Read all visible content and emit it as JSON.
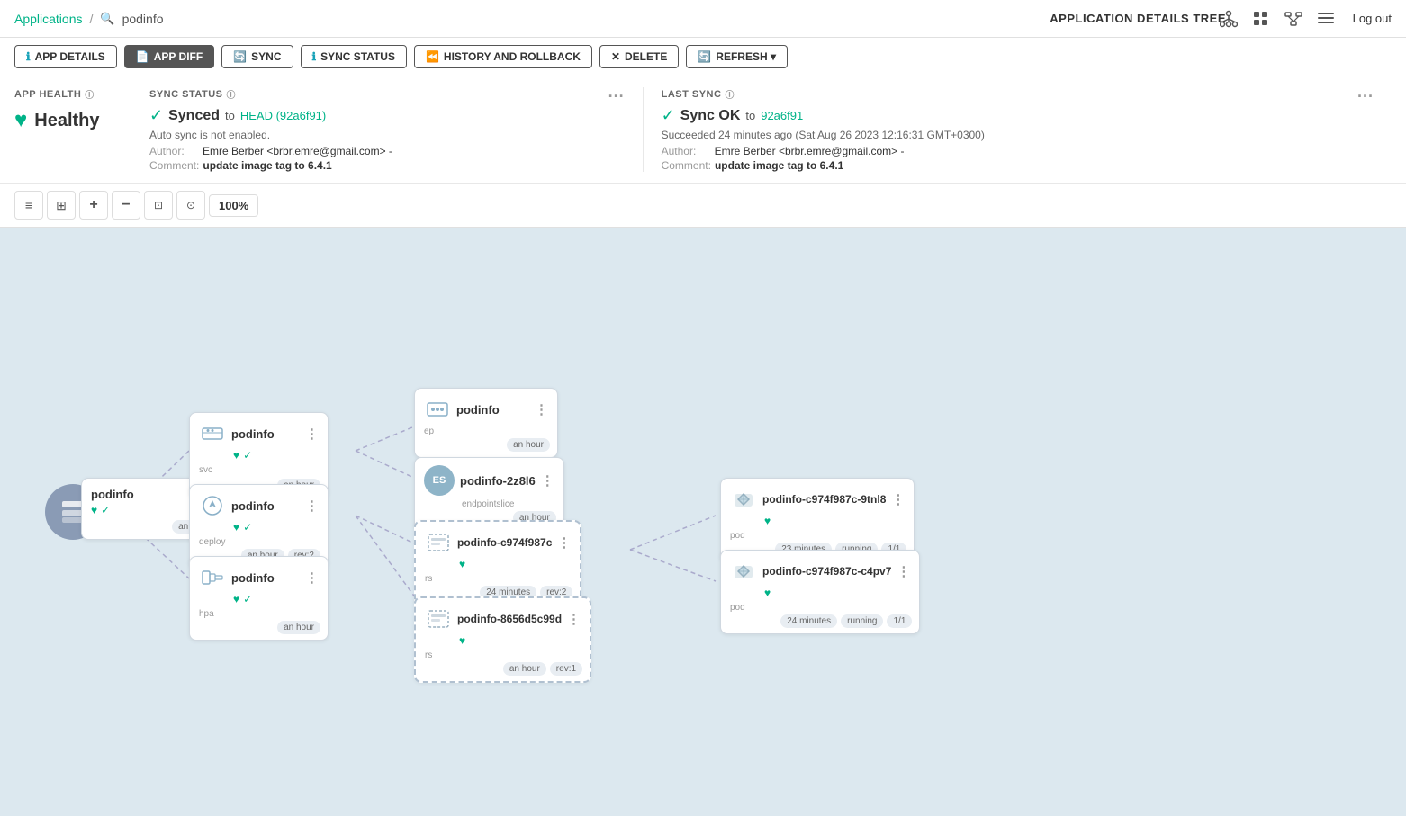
{
  "breadcrumb": {
    "app_link": "Applications",
    "separator": "/",
    "search_icon": "🔍",
    "current": "podinfo"
  },
  "header": {
    "title": "APPLICATION DETAILS TREE",
    "logout": "Log out"
  },
  "toolbar": {
    "buttons": [
      {
        "label": "APP DETAILS",
        "icon": "ℹ",
        "key": "app-details",
        "active": false
      },
      {
        "label": "APP DIFF",
        "icon": "📄",
        "key": "app-diff",
        "active": true
      },
      {
        "label": "SYNC",
        "icon": "🔄",
        "key": "sync",
        "active": false
      },
      {
        "label": "SYNC STATUS",
        "icon": "ℹ",
        "key": "sync-status",
        "active": false
      },
      {
        "label": "HISTORY AND ROLLBACK",
        "icon": "⏪",
        "key": "history",
        "active": false
      },
      {
        "label": "DELETE",
        "icon": "✕",
        "key": "delete",
        "active": false
      },
      {
        "label": "REFRESH ▾",
        "icon": "🔄",
        "key": "refresh",
        "active": false
      }
    ]
  },
  "status": {
    "app_health": {
      "label": "APP HEALTH",
      "value": "Healthy",
      "icon": "heart"
    },
    "sync_status": {
      "label": "SYNC STATUS",
      "value": "Synced",
      "to_text": "to",
      "head_link": "HEAD (92a6f91)",
      "auto_sync": "Auto sync is not enabled.",
      "author_label": "Author:",
      "author_value": "Emre Berber <brbr.emre@gmail.com> -",
      "comment_label": "Comment:",
      "comment_value": "update image tag to 6.4.1"
    },
    "last_sync": {
      "label": "LAST SYNC",
      "value": "Sync OK",
      "to_text": "to",
      "commit_link": "92a6f91",
      "succeeded_text": "Succeeded 24 minutes ago (Sat Aug 26 2023 12:16:31 GMT+0300)",
      "author_label": "Author:",
      "author_value": "Emre Berber <brbr.emre@gmail.com> -",
      "comment_label": "Comment:",
      "comment_value": "update image tag to 6.4.1"
    }
  },
  "canvas": {
    "zoom": "100%",
    "nodes": {
      "root": {
        "name": "podinfo",
        "badges": [
          "heart",
          "check"
        ],
        "time": "an hour"
      },
      "svc": {
        "name": "podinfo",
        "type": "svc",
        "badges": [
          "heart",
          "check"
        ],
        "time": "an hour"
      },
      "deploy": {
        "name": "podinfo",
        "type": "deploy",
        "badges": [
          "heart",
          "check"
        ],
        "time": "an hour",
        "rev": "rev:2"
      },
      "hpa": {
        "name": "podinfo",
        "type": "hpa",
        "badges": [
          "heart",
          "check"
        ],
        "time": "an hour"
      },
      "ep": {
        "name": "podinfo",
        "type": "ep",
        "time": "an hour"
      },
      "endpointslice": {
        "name": "podinfo-2z8l6",
        "type": "endpointslice",
        "time": "an hour"
      },
      "rs1": {
        "name": "podinfo-c974f987c",
        "type": "rs",
        "badge": "heart",
        "time": "24 minutes",
        "rev": "rev:2"
      },
      "rs2": {
        "name": "podinfo-8656d5c99d",
        "type": "rs",
        "badge": "heart",
        "time": "an hour",
        "rev": "rev:1"
      },
      "pod1": {
        "name": "podinfo-c974f987c-9tnl8",
        "type": "pod",
        "badge": "heart",
        "time": "23 minutes",
        "status": "running",
        "ratio": "1/1"
      },
      "pod2": {
        "name": "podinfo-c974f987c-c4pv7",
        "type": "pod",
        "badge": "heart",
        "time": "24 minutes",
        "status": "running",
        "ratio": "1/1"
      }
    }
  }
}
